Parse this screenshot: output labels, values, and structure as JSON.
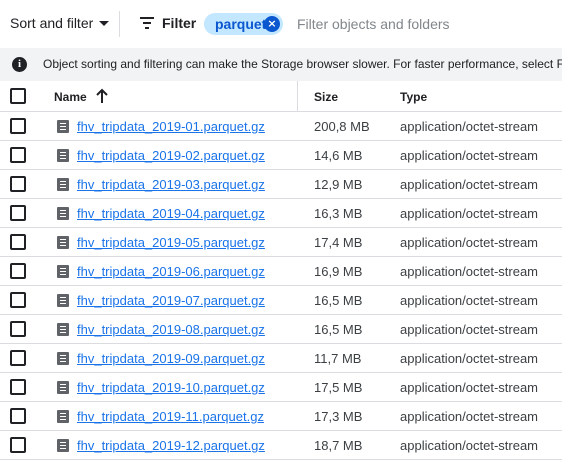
{
  "toolbar": {
    "sort_filter_label": "Sort and filter",
    "filter_label": "Filter",
    "chip_label": "parquet",
    "filter_placeholder": "Filter objects and folders"
  },
  "info_bar": {
    "icon": "info-icon",
    "text": "Object sorting and filtering can make the Storage browser slower. For faster performance, select F"
  },
  "table": {
    "columns": {
      "name": "Name",
      "size": "Size",
      "type": "Type"
    },
    "sort": {
      "column": "Name",
      "direction": "ascending"
    },
    "rows": [
      {
        "name": "fhv_tripdata_2019-01.parquet.gz",
        "size": "200,8 MB",
        "type": "application/octet-stream"
      },
      {
        "name": "fhv_tripdata_2019-02.parquet.gz",
        "size": "14,6 MB",
        "type": "application/octet-stream"
      },
      {
        "name": "fhv_tripdata_2019-03.parquet.gz",
        "size": "12,9 MB",
        "type": "application/octet-stream"
      },
      {
        "name": "fhv_tripdata_2019-04.parquet.gz",
        "size": "16,3 MB",
        "type": "application/octet-stream"
      },
      {
        "name": "fhv_tripdata_2019-05.parquet.gz",
        "size": "17,4 MB",
        "type": "application/octet-stream"
      },
      {
        "name": "fhv_tripdata_2019-06.parquet.gz",
        "size": "16,9 MB",
        "type": "application/octet-stream"
      },
      {
        "name": "fhv_tripdata_2019-07.parquet.gz",
        "size": "16,5 MB",
        "type": "application/octet-stream"
      },
      {
        "name": "fhv_tripdata_2019-08.parquet.gz",
        "size": "16,5 MB",
        "type": "application/octet-stream"
      },
      {
        "name": "fhv_tripdata_2019-09.parquet.gz",
        "size": "11,7 MB",
        "type": "application/octet-stream"
      },
      {
        "name": "fhv_tripdata_2019-10.parquet.gz",
        "size": "17,5 MB",
        "type": "application/octet-stream"
      },
      {
        "name": "fhv_tripdata_2019-11.parquet.gz",
        "size": "17,3 MB",
        "type": "application/octet-stream"
      },
      {
        "name": "fhv_tripdata_2019-12.parquet.gz",
        "size": "18,7 MB",
        "type": "application/octet-stream"
      }
    ]
  },
  "colors": {
    "link": "#1a73e8",
    "chip_bg": "#c2e7ff",
    "chip_text": "#0b57d0",
    "info_bg": "#f1f3f4"
  }
}
